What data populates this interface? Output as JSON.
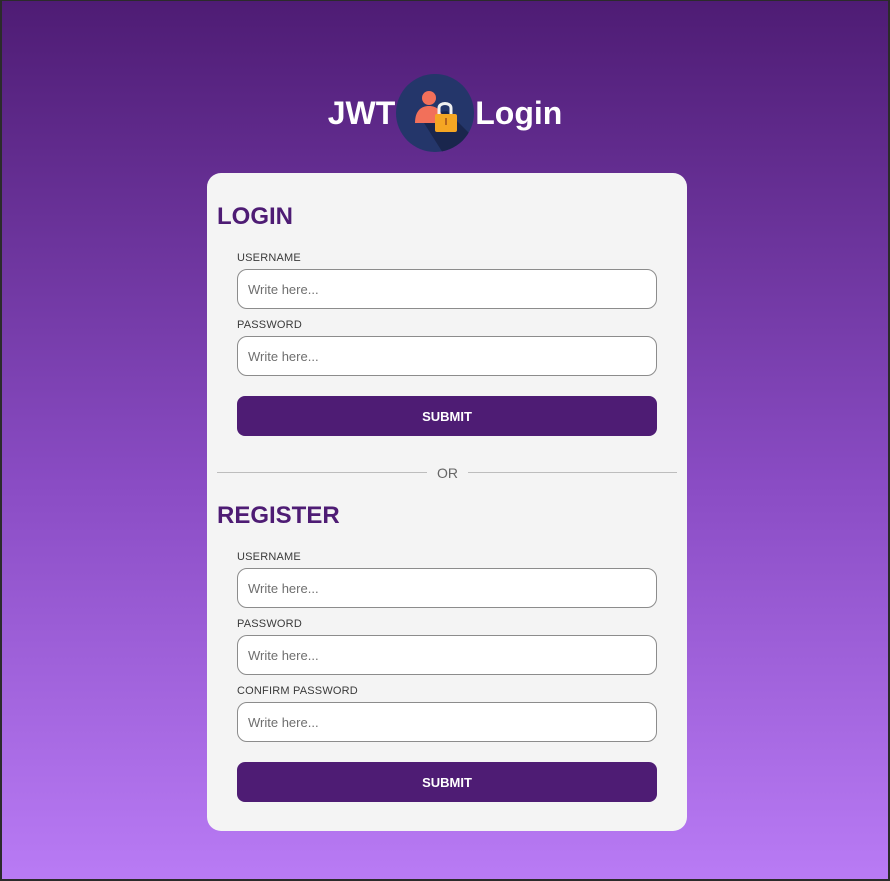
{
  "header": {
    "title_left": "JWT",
    "title_right": "Login",
    "logo_icon": "user-lock-icon"
  },
  "login": {
    "title": "LOGIN",
    "username_label": "USERNAME",
    "username_placeholder": "Write here...",
    "password_label": "PASSWORD",
    "password_placeholder": "Write here...",
    "submit_label": "SUBMIT"
  },
  "divider": {
    "text": "OR"
  },
  "register": {
    "title": "REGISTER",
    "username_label": "USERNAME",
    "username_placeholder": "Write here...",
    "password_label": "PASSWORD",
    "password_placeholder": "Write here...",
    "confirm_label": "CONFIRM PASSWORD",
    "confirm_placeholder": "Write here...",
    "submit_label": "SUBMIT"
  },
  "colors": {
    "accent": "#4e1c74",
    "card_bg": "#f4f4f4",
    "gradient_top": "#4e1c74",
    "gradient_bottom": "#b97bf5"
  }
}
